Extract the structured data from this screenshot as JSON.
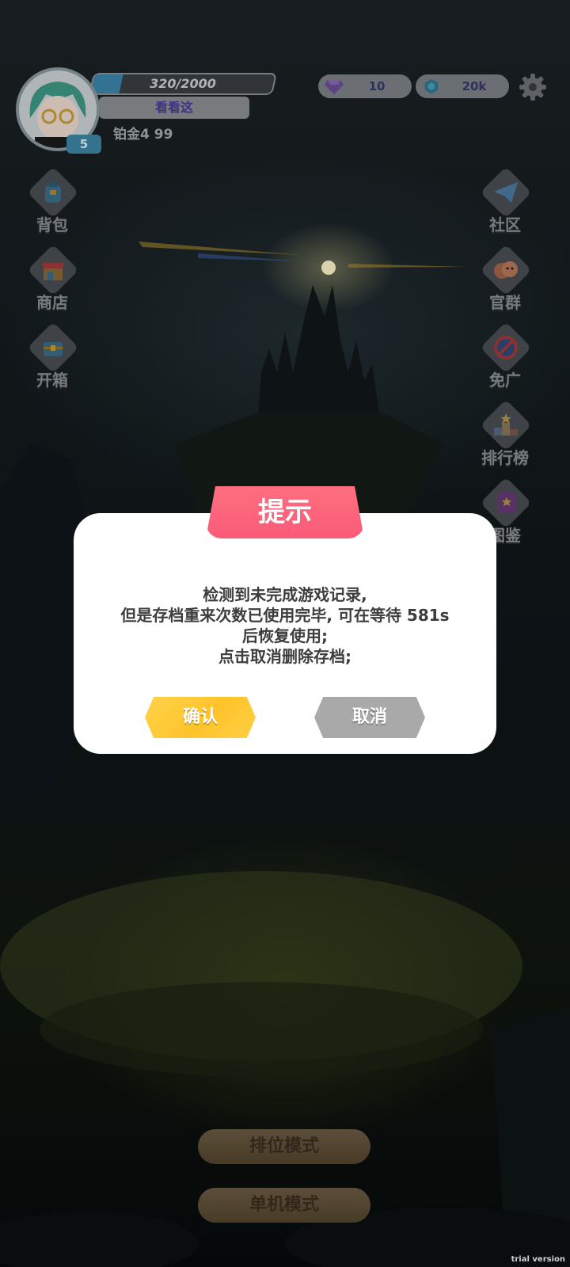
{
  "player": {
    "level": "5",
    "xp": "320/2000",
    "xp_fraction": 0.16,
    "name_button": "看看这",
    "rank": "铂金4 99"
  },
  "currency": {
    "gems": "10",
    "coins": "20k"
  },
  "left_menu": [
    {
      "label": "背包",
      "icon": "backpack-icon"
    },
    {
      "label": "商店",
      "icon": "shop-icon"
    },
    {
      "label": "开箱",
      "icon": "chest-icon"
    }
  ],
  "right_menu": [
    {
      "label": "社区",
      "icon": "paper-plane-icon"
    },
    {
      "label": "官群",
      "icon": "group-icon"
    },
    {
      "label": "免广",
      "icon": "no-ads-icon"
    },
    {
      "label": "排行榜",
      "icon": "podium-icon"
    },
    {
      "label": "图鉴",
      "icon": "book-icon"
    }
  ],
  "modes": {
    "ranked": "排位模式",
    "single": "单机模式"
  },
  "dialog": {
    "title": "提示",
    "line1": "检测到未完成游戏记录,",
    "line2": "但是存档重来次数已使用完毕, 可在等待 581s",
    "line3": "后恢复使用;",
    "line4": "点击取消删除存档;",
    "confirm": "确认",
    "cancel": "取消"
  },
  "watermark": "trial version",
  "colors": {
    "dialog_title_bg": "#f95b78",
    "confirm_bg": "#ffc32b",
    "cancel_bg": "#a9a9a9",
    "xp_fill": "#3e86ad"
  }
}
